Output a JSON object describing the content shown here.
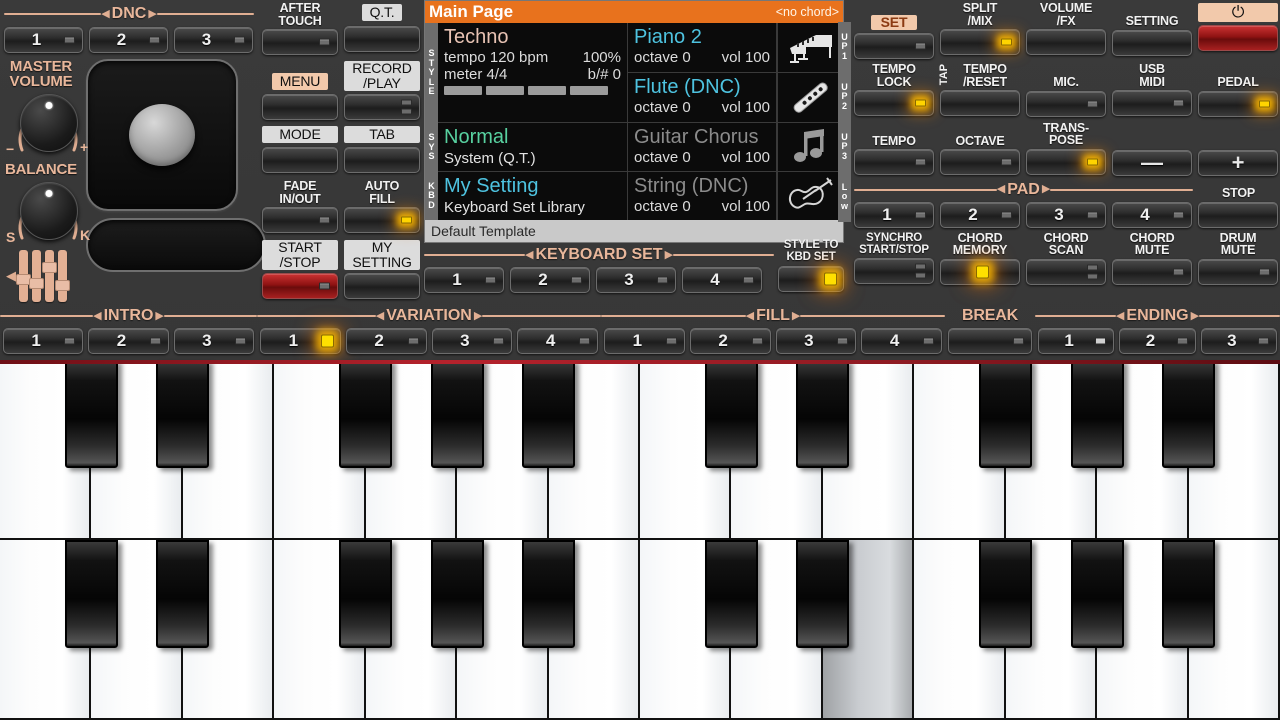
{
  "display": {
    "title": "Main Page",
    "chord": "<no chord>",
    "rails": [
      {
        "name": "style-rail",
        "letters": "STYLE"
      },
      {
        "name": "sys-rail",
        "letters": "SYS"
      },
      {
        "name": "kbd-rail",
        "letters": "KBD"
      }
    ],
    "right_rails": [
      "UP1",
      "UP2",
      "UP3",
      "Low"
    ],
    "style": {
      "name": "Techno",
      "tempo_label": "tempo 120 bpm",
      "tempo_percent": "100%",
      "meter_label": "meter 4/4",
      "key_label": "b/# 0",
      "track_bars": 4
    },
    "sys": {
      "name": "Normal",
      "sub": "System (Q.T.)"
    },
    "kbd": {
      "name": "My Setting",
      "sub": "Keyboard Set Library"
    },
    "parts": [
      {
        "name": "Piano 2",
        "octave": "octave  0",
        "vol": "vol 100",
        "icon": "grand-piano-icon",
        "active": true,
        "dnc": false
      },
      {
        "name": "Flute (DNC)",
        "octave": "octave  0",
        "vol": "vol 100",
        "icon": "flute-icon",
        "active": true,
        "dnc": true
      },
      {
        "name": "Guitar Chorus",
        "octave": "octave  0",
        "vol": "vol 100",
        "icon": "music-note-icon",
        "active": false,
        "dnc": false
      },
      {
        "name": "String (DNC)",
        "octave": "octave  0",
        "vol": "vol 100",
        "icon": "violin-icon",
        "active": false,
        "dnc": true
      }
    ],
    "footer": "Default Template",
    "colors": {
      "title_bar": "#e8721d",
      "active_part": "#4ec3e0",
      "style_name": "#e8c3b4",
      "sys_name": "#58d1a0",
      "kbd_name": "#4ec3e0"
    }
  },
  "left": {
    "dnc_group": "DNC",
    "dnc_buttons": [
      {
        "label": "1",
        "led": "off"
      },
      {
        "label": "2",
        "led": "off"
      },
      {
        "label": "3",
        "led": "off"
      }
    ],
    "master_volume_label": "MASTER\nVOLUME",
    "master_volume_line1": "MASTER",
    "master_volume_line2": "VOLUME",
    "master_minus": "−",
    "master_plus": "+",
    "balance_label": "BALANCE",
    "balance_left": "S",
    "balance_right": "K",
    "sliders_icon": "sliders-icon"
  },
  "center": {
    "buttons": [
      {
        "name": "after-touch",
        "label": "AFTER\nTOUCH",
        "l1": "AFTER",
        "l2": "TOUCH",
        "style": "plain",
        "led": "single"
      },
      {
        "name": "qt",
        "label": "Q.T.",
        "l1": "Q.T.",
        "l2": "",
        "style": "plate",
        "led": "none"
      },
      {
        "name": "menu",
        "label": "MENU",
        "l1": "MENU",
        "l2": "",
        "style": "peach",
        "led": "none"
      },
      {
        "name": "record-play",
        "label": "RECORD\n/PLAY",
        "l1": "RECORD",
        "l2": "/PLAY",
        "style": "plate",
        "led": "double"
      },
      {
        "name": "mode",
        "label": "MODE",
        "l1": "MODE",
        "l2": "",
        "style": "plate",
        "led": "none"
      },
      {
        "name": "tab",
        "label": "TAB",
        "l1": "TAB",
        "l2": "",
        "style": "plate",
        "led": "none"
      },
      {
        "name": "fade-in-out",
        "label": "FADE\nIN/OUT",
        "l1": "FADE",
        "l2": "IN/OUT",
        "style": "plain",
        "led": "single"
      },
      {
        "name": "auto-fill",
        "label": "AUTO\nFILL",
        "l1": "AUTO",
        "l2": "FILL",
        "style": "plain",
        "led": "on"
      },
      {
        "name": "start-stop",
        "label": "START\n/STOP",
        "l1": "START",
        "l2": "/STOP",
        "style": "plate",
        "led": "single",
        "red": true
      },
      {
        "name": "my-setting",
        "label": "MY\nSETTING",
        "l1": "MY",
        "l2": "SETTING",
        "style": "plate",
        "led": "none"
      }
    ]
  },
  "keyboard_set": {
    "group": "KEYBOARD SET",
    "buttons": [
      {
        "label": "1",
        "led": "off"
      },
      {
        "label": "2",
        "led": "off"
      },
      {
        "label": "3",
        "led": "off"
      },
      {
        "label": "4",
        "led": "off"
      }
    ],
    "style_to_kbd": {
      "l1": "STYLE TO",
      "l2": "KBD SET",
      "led": "on"
    }
  },
  "right": {
    "row1": [
      {
        "name": "set",
        "l1": "SET",
        "l2": "",
        "peach": true,
        "led": "single"
      },
      {
        "name": "split-mix",
        "l1": "SPLIT",
        "l2": "/MIX",
        "led": "on"
      },
      {
        "name": "volume-fx",
        "l1": "VOLUME",
        "l2": "/FX",
        "led": "none"
      },
      {
        "name": "setting",
        "l1": "SETTING",
        "l2": "",
        "led": "none"
      },
      {
        "name": "power",
        "l1": "⏻",
        "l2": "",
        "power": true,
        "led": "none"
      }
    ],
    "row2": [
      {
        "name": "tempo-lock",
        "l1": "TEMPO",
        "l2": "LOCK",
        "led": "on"
      },
      {
        "name": "tap-tempo-reset",
        "l1": "TEMPO",
        "l2": "/RESET",
        "tap": "TAP",
        "led": "none"
      },
      {
        "name": "mic",
        "l1": "MIC.",
        "l2": "",
        "led": "single"
      },
      {
        "name": "usb-midi",
        "l1": "USB",
        "l2": "MIDI",
        "led": "single"
      },
      {
        "name": "pedal",
        "l1": "PEDAL",
        "l2": "",
        "led": "on"
      }
    ],
    "row3": [
      {
        "name": "tempo",
        "l1": "TEMPO",
        "l2": "",
        "led": "single"
      },
      {
        "name": "octave",
        "l1": "OCTAVE",
        "l2": "",
        "led": "single"
      },
      {
        "name": "transpose",
        "l1": "TRANS-",
        "l2": "POSE",
        "led": "on"
      },
      {
        "name": "minus",
        "l1": "",
        "l2": "",
        "sym": "—",
        "led": "none"
      },
      {
        "name": "plus",
        "l1": "",
        "l2": "",
        "sym": "+",
        "led": "none"
      }
    ],
    "pad_group": "PAD",
    "pads": [
      {
        "label": "1",
        "led": "off"
      },
      {
        "label": "2",
        "led": "off"
      },
      {
        "label": "3",
        "led": "off"
      },
      {
        "label": "4",
        "led": "off"
      }
    ],
    "stop": {
      "l1": "STOP",
      "l2": "",
      "led": "none"
    },
    "row5": [
      {
        "name": "synchro-start-stop",
        "l1": "SYNCHRO",
        "l2": "START/STOP",
        "led": "double"
      },
      {
        "name": "chord-memory",
        "l1": "CHORD",
        "l2": "MEMORY",
        "led": "on"
      },
      {
        "name": "chord-scan",
        "l1": "CHORD",
        "l2": "SCAN",
        "led": "double"
      },
      {
        "name": "chord-mute",
        "l1": "CHORD",
        "l2": "MUTE",
        "led": "single"
      },
      {
        "name": "drum-mute",
        "l1": "DRUM",
        "l2": "MUTE",
        "led": "single"
      }
    ]
  },
  "bottom": {
    "groups": [
      {
        "name": "intro",
        "title": "INTRO",
        "buttons": [
          {
            "label": "1",
            "led": "off"
          },
          {
            "label": "2",
            "led": "off"
          },
          {
            "label": "3",
            "led": "off"
          }
        ]
      },
      {
        "name": "variation",
        "title": "VARIATION",
        "buttons": [
          {
            "label": "1",
            "led": "on"
          },
          {
            "label": "2",
            "led": "off"
          },
          {
            "label": "3",
            "led": "off"
          },
          {
            "label": "4",
            "led": "off"
          }
        ]
      },
      {
        "name": "fill",
        "title": "FILL",
        "buttons": [
          {
            "label": "1",
            "led": "off"
          },
          {
            "label": "2",
            "led": "off"
          },
          {
            "label": "3",
            "led": "off"
          },
          {
            "label": "4",
            "led": "off"
          }
        ]
      },
      {
        "name": "break",
        "title": "BREAK",
        "buttons": [
          {
            "label": "",
            "led": "off"
          }
        ]
      },
      {
        "name": "ending",
        "title": "ENDING",
        "buttons": [
          {
            "label": "1",
            "led": "bright"
          },
          {
            "label": "2",
            "led": "off"
          },
          {
            "label": "3",
            "led": "off"
          }
        ]
      }
    ]
  },
  "keys": {
    "octaves": 2,
    "rows": 2,
    "white_per_octave": 7,
    "pressed_white_index_row2": 9
  }
}
